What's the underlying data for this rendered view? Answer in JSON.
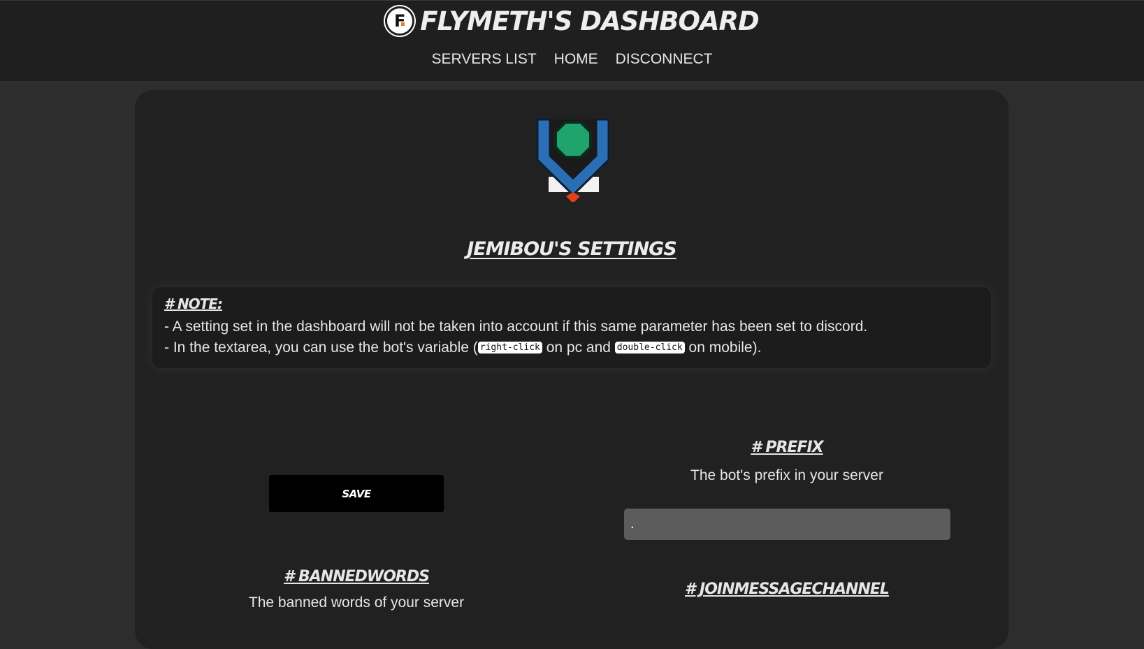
{
  "header": {
    "logo_letter": "F",
    "title": "FLYMETH'S DASHBOARD",
    "nav": [
      {
        "label": "SERVERS LIST"
      },
      {
        "label": "HOME"
      },
      {
        "label": "DISCONNECT"
      }
    ]
  },
  "page": {
    "settings_title": "JEMIBOU'S SETTINGS",
    "server_icon": "shield-gem-icon",
    "colors": {
      "accent_blue": "#2a6fb5",
      "gem_green": "#1fa46e",
      "accent_orange": "#e0401a"
    }
  },
  "note": {
    "title": "# NOTE:",
    "line1": "- A setting set in the dashboard will not be taken into account if this same parameter has been set to discord.",
    "line2_part1": "- In the textarea, you can use the bot's variable (",
    "line2_code1": "right-click",
    "line2_part2": " on pc and ",
    "line2_code2": "double-click",
    "line2_part3": " on mobile)."
  },
  "save_button": {
    "label": "SAVE"
  },
  "settings": {
    "prefix": {
      "title": "# PREFIX",
      "description": "The bot's prefix in your server",
      "value": "."
    },
    "bannedwords": {
      "title": "# BANNEDWORDS",
      "description": "The banned words of your server"
    },
    "joinmessagechannel": {
      "title": "# JOINMESSAGECHANNEL"
    }
  }
}
